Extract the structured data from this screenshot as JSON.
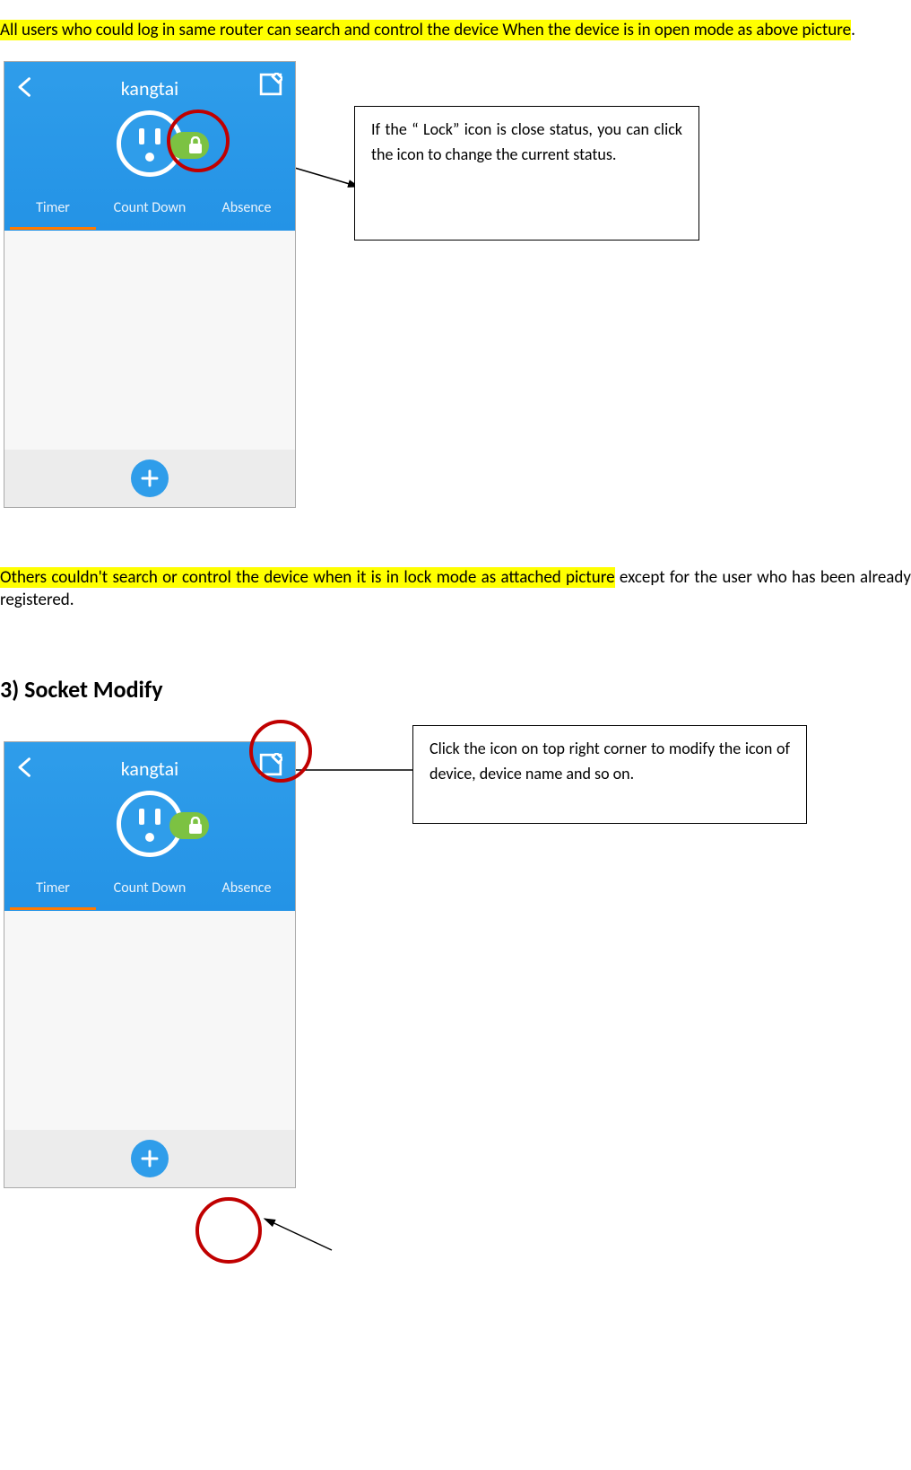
{
  "intro": {
    "line1_hl": "All users who could log in same router can search and control the device When the device is in open mode as above picture",
    "line1_tail": ".",
    "line2_hl": "Others couldn't search or control the device when it is in lock mode as attached picture",
    "line2_tail": " except for the user who has been already registered."
  },
  "section_heading": "3)  Socket Modify",
  "callouts": {
    "lock": "If the   “ Lock”  icon is close status, you can click the icon to change the current status.",
    "modify": "Click the icon on top right corner to modify the icon of device, device name and so on."
  },
  "phone": {
    "title": "kangtai",
    "tabs": [
      "Timer",
      "Count Down",
      "Absence"
    ],
    "active_tab_index": 0
  },
  "colors": {
    "header": "#2f9dea",
    "accent": "#ff7a00",
    "lock_pill": "#7cc242",
    "highlight": "#ffff00",
    "annotation": "#c00000"
  }
}
